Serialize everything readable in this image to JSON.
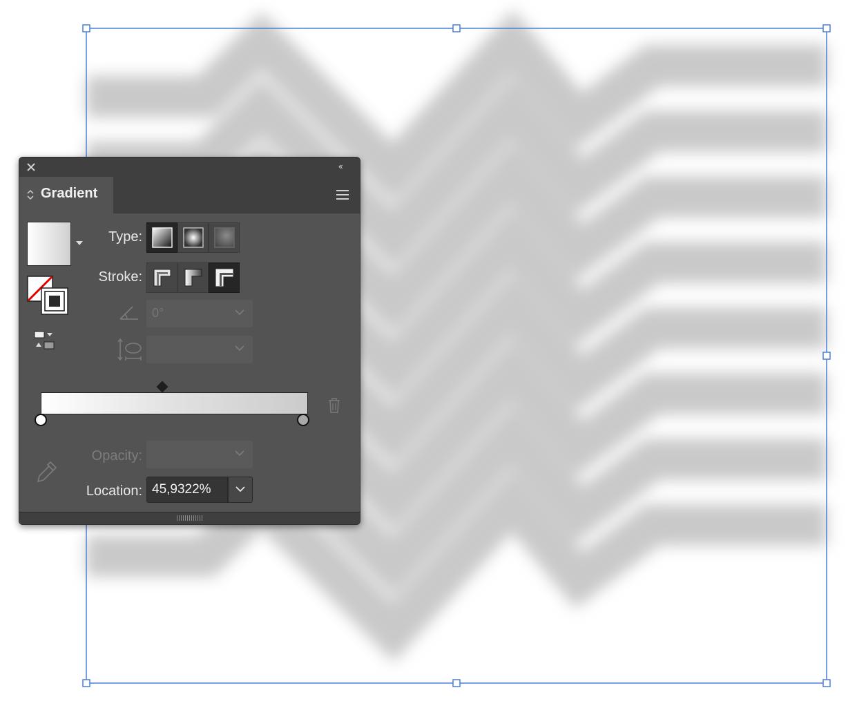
{
  "panel": {
    "title": "Gradient",
    "type_label": "Type:",
    "type_options": [
      "linear-gradient-icon",
      "radial-gradient-icon",
      "freeform-gradient-icon"
    ],
    "type_selected": "linear-gradient-icon",
    "stroke_label": "Stroke:",
    "stroke_options": [
      "stroke-within-icon",
      "stroke-along-icon",
      "stroke-across-icon"
    ],
    "stroke_selected": "stroke-across-icon",
    "angle_value": "0°",
    "aspect_value": "",
    "opacity_label": "Opacity:",
    "opacity_value": "",
    "location_label": "Location:",
    "location_value": "45,9322%"
  },
  "gradient": {
    "stops": [
      {
        "location": 0,
        "color": "#ffffff"
      },
      {
        "location": 100,
        "color": "#a9a9a9"
      }
    ],
    "midpoint": 45.9322
  },
  "colors": {
    "panel_bg": "#535353",
    "panel_dark": "#3f3f3f",
    "selection_blue": "#4a7fd8",
    "artwork_gray": "#c9c9c9"
  }
}
